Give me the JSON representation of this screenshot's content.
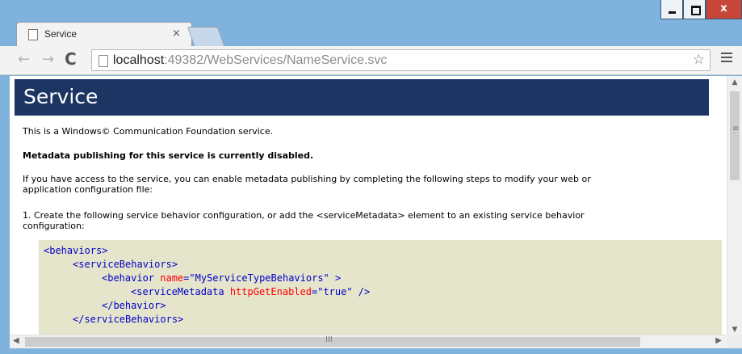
{
  "browser": {
    "tab": {
      "title": "Service",
      "close_label": "×"
    },
    "window_controls": {
      "close_label": "x"
    },
    "toolbar": {
      "back_glyph": "←",
      "forward_glyph": "→",
      "reload_glyph": "C",
      "url_host": "localhost",
      "url_rest": ":49382/WebServices/NameService.svc",
      "star_glyph": "☆"
    },
    "icons": [
      "page-icon",
      "back-arrow-icon",
      "forward-arrow-icon",
      "reload-icon",
      "star-icon",
      "menu-icon",
      "minimize-icon",
      "maximize-icon",
      "close-icon"
    ]
  },
  "page": {
    "heading": "Service",
    "intro": "This is a Windows© Communication Foundation service.",
    "metadata_notice": "Metadata publishing for this service is currently disabled.",
    "instructions_line1": "If you have access to the service, you can enable metadata publishing by completing the following steps to modify your web or",
    "instructions_line2": "application configuration file:",
    "step1_line1": "1. Create the following service behavior configuration, or add the <serviceMetadata> element to an existing service behavior",
    "step1_line2": "configuration:",
    "code": {
      "l1_tag": "<behaviors>",
      "l2_tag": "<serviceBehaviors>",
      "l3_tag_open": "<behavior ",
      "l3_attr": "name",
      "l3_eq": "=",
      "l3_val": "\"MyServiceTypeBehaviors\"",
      "l3_close": " >",
      "l4_tag_open": "<serviceMetadata ",
      "l4_attr": "httpGetEnabled",
      "l4_eq": "=",
      "l4_val": "\"true\"",
      "l4_close": " />",
      "l5_tag": "</behavior>",
      "l6_tag": "</serviceBehaviors>"
    }
  },
  "scrollbars": {
    "h_grip": "III",
    "v_grip": "≡"
  }
}
